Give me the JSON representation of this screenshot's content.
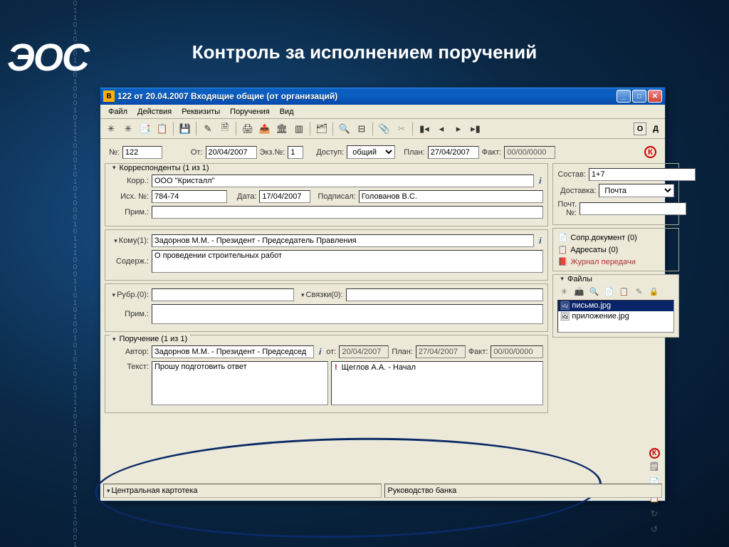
{
  "slide": {
    "logo": "ЭОС",
    "title": "Контроль за исполнением поручений"
  },
  "window": {
    "title": "122 от 20.04.2007 Входящие общие (от организаций)",
    "menu": [
      "Файл",
      "Действия",
      "Реквизиты",
      "Поручения",
      "Вид"
    ],
    "toolbar_right": [
      "О",
      "Д"
    ]
  },
  "header": {
    "num_label": "№:",
    "num": "122",
    "from_label": "От:",
    "from": "20/04/2007",
    "copy_label": "Экз.№:",
    "copy": "1",
    "access_label": "Доступ:",
    "access": "общий",
    "plan_label": "План:",
    "plan": "27/04/2007",
    "fact_label": "Факт:",
    "fact": "00/00/0000",
    "k": "К"
  },
  "corr": {
    "title": "Корреспонденты (1 из 1)",
    "korr_label": "Корр.:",
    "korr": "ООО \"Кристалл\"",
    "out_label": "Исх. №:",
    "out": "784-74",
    "date_label": "Дата:",
    "date": "17/04/2007",
    "signed_label": "Подписал:",
    "signed": "Голованов В.С.",
    "note_label": "Прим.:",
    "note": ""
  },
  "to": {
    "title": "Кому(1):",
    "value": "Задорнов М.М. - Президент - Председатель Правления",
    "content_label": "Содерж.:",
    "content": "О проведении строительных работ"
  },
  "rubr": {
    "title": "Рубр.(0):",
    "links_title": "Связки(0):",
    "note_label": "Прим.:",
    "note": ""
  },
  "assign": {
    "title": "Поручение (1 из 1)",
    "author_label": "Автор:",
    "author": "Задорнов М.М. - Президент - Председсед",
    "from_label": "от:",
    "from": "20/04/2007",
    "plan_label": "План:",
    "plan": "27/04/2007",
    "fact_label": "Факт:",
    "fact": "00/00/0000",
    "text_label": "Текст:",
    "text": "Прошу подготовить ответ",
    "executor_mark": "!",
    "executor": "Щеглов А.А. - Начал"
  },
  "side": {
    "composition_label": "Состав:",
    "composition": "1+7",
    "delivery_label": "Доставка:",
    "delivery": "Почта",
    "postnum_label": "Почт. №:",
    "postnum": "",
    "links": [
      {
        "label": "Сопр.документ (0)",
        "icon": "📄"
      },
      {
        "label": "Адресаты (0)",
        "icon": "📋"
      },
      {
        "label": "Журнал передачи",
        "icon": "📕",
        "red": true
      }
    ],
    "files_title": "Файлы",
    "files": [
      {
        "name": "письмо.jpg",
        "sel": true
      },
      {
        "name": "приложение.jpg",
        "sel": false
      }
    ]
  },
  "status": {
    "left": "Центральная картотека",
    "right": "Руководство банка"
  }
}
